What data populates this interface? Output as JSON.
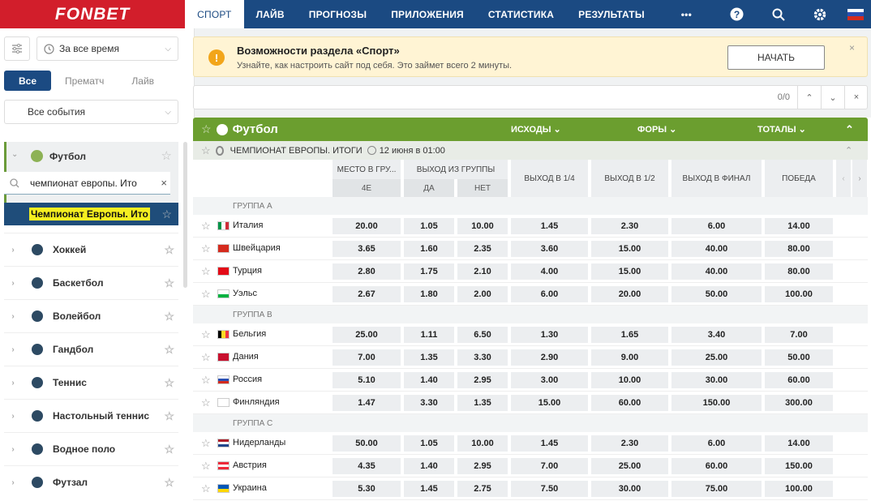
{
  "brand": {
    "logo": "FONBET",
    "logo_color": "#d21e2b",
    "nav_color": "#1b4a82"
  },
  "nav": {
    "items": [
      "СПОРТ",
      "ЛАЙВ",
      "ПРОГНОЗЫ",
      "ПРИЛОЖЕНИЯ",
      "СТАТИСТИКА",
      "РЕЗУЛЬТАТЫ"
    ],
    "more": "•••",
    "icons": [
      "help-icon",
      "search-icon",
      "gear-icon",
      "flag-ru-icon"
    ]
  },
  "sidebar": {
    "time_filter": "За все время",
    "tabs": [
      "Все",
      "Прематч",
      "Лайв"
    ],
    "events_filter": "Все события",
    "football": "Футбол",
    "search_value": "чемпионат европы. Ито",
    "champ_item": "Чемпионат Европы. Ито",
    "sports": [
      "Хоккей",
      "Баскетбол",
      "Волейбол",
      "Гандбол",
      "Теннис",
      "Настольный теннис",
      "Водное поло",
      "Футзал"
    ]
  },
  "info": {
    "icon": "!",
    "title": "Возможности раздела «Спорт»",
    "subtitle": "Узнайте, как настроить сайт под себя. Это займет всего 2 минуты.",
    "button": "НАЧАТЬ",
    "close": "×"
  },
  "searchbar": {
    "count": "0/0"
  },
  "table": {
    "sport": "Футбол",
    "cols": {
      "outcomes": "ИСХОДЫ",
      "handicap": "ФОРЫ",
      "totals": "ТОТАЛЫ"
    },
    "championship": "ЧЕМПИОНАТ ЕВРОПЫ. ИТОГИ",
    "date": "12 июня в 01:00",
    "headers": {
      "place": "МЕСТО В ГРУ...",
      "place_sub": "4Е",
      "exit_group": "ВЫХОД ИЗ ГРУППЫ",
      "yes": "ДА",
      "no": "НЕТ",
      "q14": "ВЫХОД В 1/4",
      "q12": "ВЫХОД В 1/2",
      "final": "ВЫХОД В ФИНАЛ",
      "win": "ПОБЕДА"
    },
    "groups": [
      {
        "label": "ГРУППА A",
        "teams": [
          {
            "name": "Италия",
            "odds": [
              "20.00",
              "1.05",
              "10.00",
              "1.45",
              "2.30",
              "6.00",
              "14.00"
            ]
          },
          {
            "name": "Швейцария",
            "odds": [
              "3.65",
              "1.60",
              "2.35",
              "3.60",
              "15.00",
              "40.00",
              "80.00"
            ]
          },
          {
            "name": "Турция",
            "odds": [
              "2.80",
              "1.75",
              "2.10",
              "4.00",
              "15.00",
              "40.00",
              "80.00"
            ]
          },
          {
            "name": "Уэльс",
            "odds": [
              "2.67",
              "1.80",
              "2.00",
              "6.00",
              "20.00",
              "50.00",
              "100.00"
            ]
          }
        ]
      },
      {
        "label": "ГРУППА B",
        "teams": [
          {
            "name": "Бельгия",
            "odds": [
              "25.00",
              "1.11",
              "6.50",
              "1.30",
              "1.65",
              "3.40",
              "7.00"
            ]
          },
          {
            "name": "Дания",
            "odds": [
              "7.00",
              "1.35",
              "3.30",
              "2.90",
              "9.00",
              "25.00",
              "50.00"
            ]
          },
          {
            "name": "Россия",
            "odds": [
              "5.10",
              "1.40",
              "2.95",
              "3.00",
              "10.00",
              "30.00",
              "60.00"
            ]
          },
          {
            "name": "Финляндия",
            "odds": [
              "1.47",
              "3.30",
              "1.35",
              "15.00",
              "60.00",
              "150.00",
              "300.00"
            ]
          }
        ]
      },
      {
        "label": "ГРУППА C",
        "teams": [
          {
            "name": "Нидерланды",
            "odds": [
              "50.00",
              "1.05",
              "10.00",
              "1.45",
              "2.30",
              "6.00",
              "14.00"
            ]
          },
          {
            "name": "Австрия",
            "odds": [
              "4.35",
              "1.40",
              "2.95",
              "7.00",
              "25.00",
              "60.00",
              "150.00"
            ]
          },
          {
            "name": "Украина",
            "odds": [
              "5.30",
              "1.45",
              "2.75",
              "7.50",
              "30.00",
              "75.00",
              "100.00"
            ]
          }
        ]
      }
    ]
  }
}
